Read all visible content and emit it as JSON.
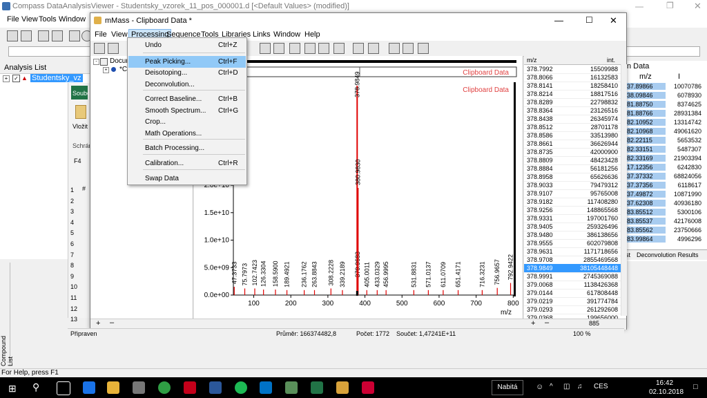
{
  "outer": {
    "title": "Compass DataAnalysisViewer - Studentsky_vzorek_11_pos_000001.d [<Default Values> (modified)]",
    "menu": [
      "File",
      "View",
      "Tools",
      "Window"
    ],
    "analysis_list_label": "Analysis List",
    "analysis_item": "Studentsky_vz",
    "status_left": "Připraven",
    "status_mean": "Průměr: 166374482,8",
    "status_count": "Počet: 1772",
    "status_sum": "Součet: 1,47241E+11",
    "zoom": "100 %",
    "help_text": "For Help, press F1",
    "compound_list_label": "Compound List"
  },
  "excel": {
    "tab": "Soubo",
    "paste": "Vložit",
    "clipboard": "Schrár",
    "cell": "F4",
    "rows": [
      "1",
      "2",
      "3",
      "4",
      "5",
      "6",
      "7",
      "8",
      "9",
      "10",
      "11",
      "12",
      "13"
    ],
    "col_hash": "#"
  },
  "right_panel": {
    "header": "n Data",
    "col_mz": "m/z",
    "col_i": "I",
    "tab1": "st",
    "tab2": "Deconvolution Results",
    "rows": [
      [
        "37.89866",
        "10070786"
      ],
      [
        "38.09846",
        "6078930"
      ],
      [
        "81.88750",
        "8374625"
      ],
      [
        "81.88766",
        "28931384"
      ],
      [
        "82.10952",
        "13314742"
      ],
      [
        "82.10968",
        "49061620"
      ],
      [
        "82.22115",
        "5653532"
      ],
      [
        "82.33151",
        "5487307"
      ],
      [
        "82.33169",
        "21903394"
      ],
      [
        "17.12356",
        "6242830"
      ],
      [
        "37.37332",
        "68824056"
      ],
      [
        "37.37356",
        "6118617"
      ],
      [
        "37.49872",
        "10871990"
      ],
      [
        "37.62308",
        "40936180"
      ],
      [
        "83.85512",
        "5300106"
      ],
      [
        "83.85537",
        "42176008"
      ],
      [
        "83.85562",
        "23750666"
      ],
      [
        "83.99864",
        "4996296"
      ]
    ]
  },
  "mmass": {
    "title": "mMass - Clipboard Data *",
    "menu": [
      "File",
      "View",
      "Processing",
      "Sequence",
      "Tools",
      "Libraries",
      "Links",
      "Window",
      "Help"
    ],
    "tree_root": "Docum",
    "tree_child": "*C",
    "plot_label": "Clipboard Data",
    "plot_label2": "Clipboard Data",
    "xaxis_unit": "m/z",
    "list_headers": [
      "m/z",
      "int."
    ],
    "count": "885"
  },
  "processing_menu": [
    {
      "label": "Undo",
      "shortcut": "Ctrl+Z"
    },
    {
      "label": "Peak Picking...",
      "shortcut": "Ctrl+F"
    },
    {
      "label": "Deisotoping...",
      "shortcut": "Ctrl+D"
    },
    {
      "label": "Deconvolution...",
      "shortcut": ""
    },
    {
      "label": "Correct Baseline...",
      "shortcut": "Ctrl+B"
    },
    {
      "label": "Smooth Spectrum...",
      "shortcut": "Ctrl+G"
    },
    {
      "label": "Crop...",
      "shortcut": ""
    },
    {
      "label": "Math Operations...",
      "shortcut": ""
    },
    {
      "label": "Batch Processing...",
      "shortcut": ""
    },
    {
      "label": "Calibration...",
      "shortcut": "Ctrl+R"
    },
    {
      "label": "Swap Data",
      "shortcut": ""
    }
  ],
  "peak_list": [
    [
      "378.7992",
      "15509988"
    ],
    [
      "378.8066",
      "16132583"
    ],
    [
      "378.8141",
      "18258410"
    ],
    [
      "378.8214",
      "18817516"
    ],
    [
      "378.8289",
      "22798832"
    ],
    [
      "378.8364",
      "23126516"
    ],
    [
      "378.8438",
      "26345974"
    ],
    [
      "378.8512",
      "28701178"
    ],
    [
      "378.8586",
      "33513980"
    ],
    [
      "378.8661",
      "36626944"
    ],
    [
      "378.8735",
      "42000900"
    ],
    [
      "378.8809",
      "48423428"
    ],
    [
      "378.8884",
      "56181256"
    ],
    [
      "378.8958",
      "65626636"
    ],
    [
      "378.9033",
      "79479312"
    ],
    [
      "378.9107",
      "95765008"
    ],
    [
      "378.9182",
      "117408280"
    ],
    [
      "378.9256",
      "148865568"
    ],
    [
      "378.9331",
      "197001760"
    ],
    [
      "378.9405",
      "259326496"
    ],
    [
      "378.9480",
      "386138656"
    ],
    [
      "378.9555",
      "602079808"
    ],
    [
      "378.9631",
      "1171718656"
    ],
    [
      "378.9708",
      "2855469568"
    ],
    [
      "378.9849",
      "38105448448"
    ],
    [
      "378.9991",
      "2745369088"
    ],
    [
      "379.0068",
      "1138426368"
    ],
    [
      "379.0144",
      "617808448"
    ],
    [
      "379.0219",
      "391774784"
    ],
    [
      "379.0293",
      "261292608"
    ],
    [
      "379.0368",
      "199656000"
    ]
  ],
  "chart_data": {
    "type": "line",
    "xlabel": "m/z",
    "ylabel": "",
    "xlim": [
      45,
      805
    ],
    "ylim": [
      0,
      38500000000
    ],
    "x_ticks": [
      100,
      200,
      300,
      400,
      500,
      600,
      700,
      800
    ],
    "y_ticks": [
      "0.0e+00",
      "5.0e+09",
      "1.0e+10",
      "1.5e+10",
      "2.0e+10",
      "2.5e+10"
    ],
    "y_tick_values": [
      0,
      5000000000,
      10000000000,
      15000000000,
      20000000000,
      25000000000
    ],
    "peaks": [
      {
        "x": 47.3733,
        "y": 1500000000,
        "label": "47.3733"
      },
      {
        "x": 75.7973,
        "y": 1200000000,
        "label": "75.7973"
      },
      {
        "x": 102.7423,
        "y": 1200000000,
        "label": "102.7423"
      },
      {
        "x": 126.3304,
        "y": 1000000000,
        "label": "126.3304"
      },
      {
        "x": 158.59,
        "y": 1000000000,
        "label": "158.5900"
      },
      {
        "x": 189.4921,
        "y": 900000000,
        "label": "189.4921"
      },
      {
        "x": 236.1762,
        "y": 900000000,
        "label": "236.1762"
      },
      {
        "x": 263.8843,
        "y": 900000000,
        "label": "263.8843"
      },
      {
        "x": 308.2228,
        "y": 1200000000,
        "label": "308.2228"
      },
      {
        "x": 339.2189,
        "y": 900000000,
        "label": "339.2189"
      },
      {
        "x": 378.9849,
        "y": 38105448448,
        "label": "378.9849"
      },
      {
        "x": 379.9683,
        "y": 2700000000,
        "label": "379.9683"
      },
      {
        "x": 380.983,
        "y": 19500000000,
        "label": "380.9830"
      },
      {
        "x": 405.0011,
        "y": 900000000,
        "label": "405.0011"
      },
      {
        "x": 433.0329,
        "y": 900000000,
        "label": "433.0329"
      },
      {
        "x": 456.9995,
        "y": 900000000,
        "label": "456.9995"
      },
      {
        "x": 531.8831,
        "y": 900000000,
        "label": "531.8831"
      },
      {
        "x": 571.0137,
        "y": 900000000,
        "label": "571.0137"
      },
      {
        "x": 611.0709,
        "y": 900000000,
        "label": "611.0709"
      },
      {
        "x": 651.4171,
        "y": 900000000,
        "label": "651.4171"
      },
      {
        "x": 716.3231,
        "y": 900000000,
        "label": "716.3231"
      },
      {
        "x": 756.9657,
        "y": 1300000000,
        "label": "756.9657"
      },
      {
        "x": 792.9422,
        "y": 2200000000,
        "label": "792.9422"
      }
    ]
  },
  "taskbar": {
    "tray_label": "Nabitá",
    "lang": "CES",
    "time": "16:42",
    "date": "02.10.2018"
  },
  "colors": {
    "peak": "#e00000",
    "selection": "#3399ff",
    "menu_highlight": "#91c9f7",
    "excel_green": "#217346"
  }
}
